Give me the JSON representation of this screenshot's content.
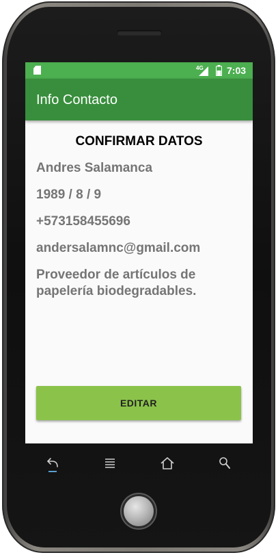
{
  "status_bar": {
    "network_label": "4G",
    "time": "7:03",
    "icons": [
      "sim-card-icon",
      "signal-icon",
      "battery-icon"
    ],
    "color": "#4caf50"
  },
  "app_bar": {
    "title": "Info Contacto",
    "color": "#388e3c"
  },
  "content": {
    "heading": "CONFIRMAR DATOS",
    "name": "Andres Salamanca",
    "birth_date": "1989 / 8 / 9",
    "phone": "+573158455696",
    "email": "andersalamnc@gmail.com",
    "description": "Proveedor de artículos de papelería biodegradables."
  },
  "edit_button": {
    "label": "EDITAR",
    "color": "#8bc34a"
  },
  "device_keys": [
    "back-icon",
    "menu-icon",
    "home-icon",
    "search-icon"
  ]
}
